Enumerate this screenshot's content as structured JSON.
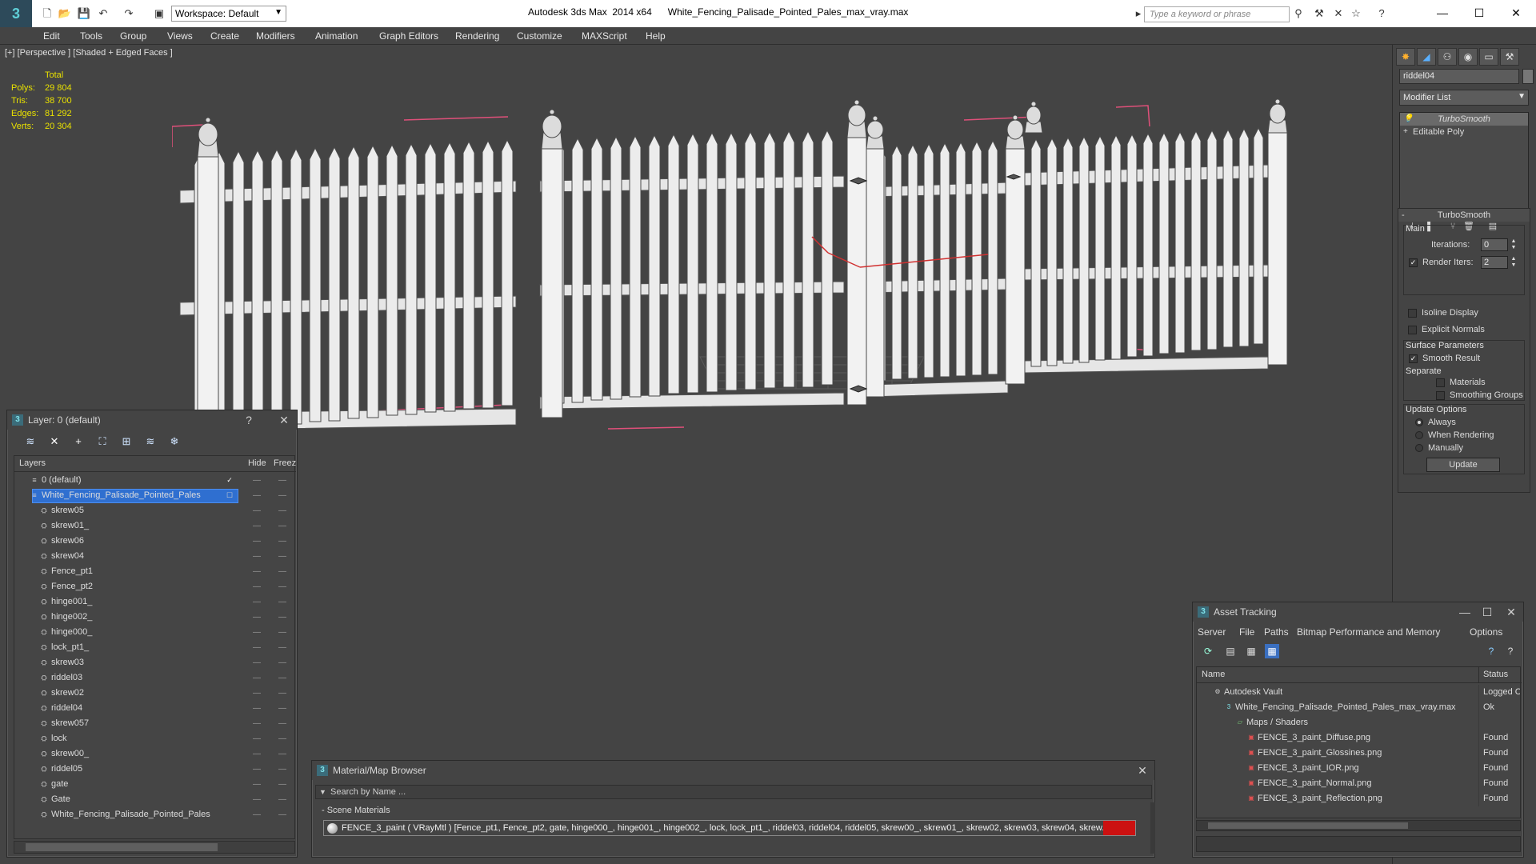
{
  "titlebar": {
    "workspace": "Workspace: Default",
    "app_title": "Autodesk 3ds Max  2014 x64",
    "file_title": "White_Fencing_Palisade_Pointed_Pales_max_vray.max",
    "search_placeholder": "Type a keyword or phrase"
  },
  "menu": [
    "Edit",
    "Tools",
    "Group",
    "Views",
    "Create",
    "Modifiers",
    "Animation",
    "Graph Editors",
    "Rendering",
    "Customize",
    "MAXScript",
    "Help"
  ],
  "viewport": {
    "label": "[+] [Perspective ] [Shaded + Edged Faces ]",
    "stats": {
      "header": "Total",
      "rows": [
        {
          "label": "Polys:",
          "value": "29 804"
        },
        {
          "label": "Tris:",
          "value": "38 700"
        },
        {
          "label": "Edges:",
          "value": "81 292"
        },
        {
          "label": "Verts:",
          "value": "20 304"
        }
      ]
    }
  },
  "command_panel": {
    "object_name": "riddel04",
    "modifier_list": "Modifier List",
    "stack": [
      {
        "label": "TurboSmooth",
        "selected": true
      },
      {
        "label": "Editable Poly",
        "selected": false
      }
    ],
    "turbosmooth": {
      "title": "TurboSmooth",
      "main_label": "Main",
      "iterations_label": "Iterations:",
      "iterations_value": "0",
      "render_iters_label": "Render Iters:",
      "render_iters_value": "2",
      "isoline": "Isoline Display",
      "explicit_normals": "Explicit Normals",
      "surface_params": "Surface Parameters",
      "smooth_result": "Smooth Result",
      "separate": "Separate",
      "materials": "Materials",
      "smoothing_groups": "Smoothing Groups",
      "update_options": "Update Options",
      "always": "Always",
      "when_rendering": "When Rendering",
      "manually": "Manually",
      "update_btn": "Update"
    }
  },
  "layer_panel": {
    "title": "Layer: 0 (default)",
    "help": "?",
    "col_layers": "Layers",
    "col_hide": "Hide",
    "col_freeze": "Freez",
    "rows": [
      {
        "name": "0 (default)",
        "level": 0,
        "type": "layer"
      },
      {
        "name": "White_Fencing_Palisade_Pointed_Pales",
        "level": 0,
        "type": "layer",
        "selected": true
      },
      {
        "name": "skrew05",
        "level": 1,
        "type": "object"
      },
      {
        "name": "skrew01_",
        "level": 1,
        "type": "object"
      },
      {
        "name": "skrew06",
        "level": 1,
        "type": "object"
      },
      {
        "name": "skrew04",
        "level": 1,
        "type": "object"
      },
      {
        "name": "Fence_pt1",
        "level": 1,
        "type": "object"
      },
      {
        "name": "Fence_pt2",
        "level": 1,
        "type": "object"
      },
      {
        "name": "hinge001_",
        "level": 1,
        "type": "object"
      },
      {
        "name": "hinge002_",
        "level": 1,
        "type": "object"
      },
      {
        "name": "hinge000_",
        "level": 1,
        "type": "object"
      },
      {
        "name": "lock_pt1_",
        "level": 1,
        "type": "object"
      },
      {
        "name": "skrew03",
        "level": 1,
        "type": "object"
      },
      {
        "name": "riddel03",
        "level": 1,
        "type": "object"
      },
      {
        "name": "skrew02",
        "level": 1,
        "type": "object"
      },
      {
        "name": "riddel04",
        "level": 1,
        "type": "object"
      },
      {
        "name": "skrew057",
        "level": 1,
        "type": "object"
      },
      {
        "name": "lock",
        "level": 1,
        "type": "object"
      },
      {
        "name": "skrew00_",
        "level": 1,
        "type": "object"
      },
      {
        "name": "riddel05",
        "level": 1,
        "type": "object"
      },
      {
        "name": "gate",
        "level": 1,
        "type": "object"
      },
      {
        "name": "Gate",
        "level": 1,
        "type": "object"
      },
      {
        "name": "White_Fencing_Palisade_Pointed_Pales",
        "level": 1,
        "type": "object"
      }
    ]
  },
  "material_browser": {
    "title": "Material/Map Browser",
    "search_placeholder": "Search by Name ...",
    "section": "- Scene Materials",
    "material_row": "FENCE_3_paint  ( VRayMtl )  [Fence_pt1, Fence_pt2, gate, hinge000_, hinge001_, hinge002_, lock, lock_pt1_, riddel03, riddel04, riddel05, skrew00_, skrew01_, skrew02, skrew03, skrew04, skrew..."
  },
  "asset_tracking": {
    "title": "Asset Tracking",
    "menu": [
      "Server",
      "File",
      "Paths",
      "Bitmap Performance and Memory",
      "Options"
    ],
    "col_name": "Name",
    "col_status": "Status",
    "rows": [
      {
        "name": "Autodesk Vault",
        "status": "Logged C",
        "indent": 1,
        "icon": "vault"
      },
      {
        "name": "White_Fencing_Palisade_Pointed_Pales_max_vray.max",
        "status": "Ok",
        "indent": 2,
        "icon": "max"
      },
      {
        "name": "Maps / Shaders",
        "status": "",
        "indent": 3,
        "icon": "folder"
      },
      {
        "name": "FENCE_3_paint_Diffuse.png",
        "status": "Found",
        "indent": 4,
        "icon": "png"
      },
      {
        "name": "FENCE_3_paint_Glossines.png",
        "status": "Found",
        "indent": 4,
        "icon": "png"
      },
      {
        "name": "FENCE_3_paint_IOR.png",
        "status": "Found",
        "indent": 4,
        "icon": "png"
      },
      {
        "name": "FENCE_3_paint_Normal.png",
        "status": "Found",
        "indent": 4,
        "icon": "png"
      },
      {
        "name": "FENCE_3_paint_Reflection.png",
        "status": "Found",
        "indent": 4,
        "icon": "png"
      }
    ]
  },
  "colors": {
    "background": "#444444",
    "stats_yellow": "#e9e100",
    "selection_blue": "#2f6fd0",
    "fence_white": "#e6e6e6",
    "bbox_pink": "#e0507a",
    "material_red": "#cc1111"
  }
}
